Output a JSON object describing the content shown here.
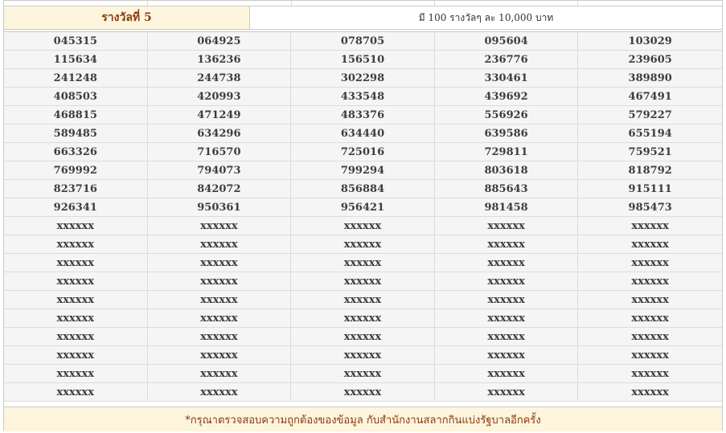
{
  "prize": {
    "title": "รางวัลที่ 5",
    "description": "มี 100 รางวัลๆ ละ 10,000 บาท"
  },
  "numbers": [
    [
      "045315",
      "064925",
      "078705",
      "095604",
      "103029"
    ],
    [
      "115634",
      "136236",
      "156510",
      "236776",
      "239605"
    ],
    [
      "241248",
      "244738",
      "302298",
      "330461",
      "389890"
    ],
    [
      "408503",
      "420993",
      "433548",
      "439692",
      "467491"
    ],
    [
      "468815",
      "471249",
      "483376",
      "556926",
      "579227"
    ],
    [
      "589485",
      "634296",
      "634440",
      "639586",
      "655194"
    ],
    [
      "663326",
      "716570",
      "725016",
      "729811",
      "759521"
    ],
    [
      "769992",
      "794073",
      "799294",
      "803618",
      "818792"
    ],
    [
      "823716",
      "842072",
      "856884",
      "885643",
      "915111"
    ],
    [
      "926341",
      "950361",
      "956421",
      "981458",
      "985473"
    ],
    [
      "xxxxxx",
      "xxxxxx",
      "xxxxxx",
      "xxxxxx",
      "xxxxxx"
    ],
    [
      "xxxxxx",
      "xxxxxx",
      "xxxxxx",
      "xxxxxx",
      "xxxxxx"
    ],
    [
      "xxxxxx",
      "xxxxxx",
      "xxxxxx",
      "xxxxxx",
      "xxxxxx"
    ],
    [
      "xxxxxx",
      "xxxxxx",
      "xxxxxx",
      "xxxxxx",
      "xxxxxx"
    ],
    [
      "xxxxxx",
      "xxxxxx",
      "xxxxxx",
      "xxxxxx",
      "xxxxxx"
    ],
    [
      "xxxxxx",
      "xxxxxx",
      "xxxxxx",
      "xxxxxx",
      "xxxxxx"
    ],
    [
      "xxxxxx",
      "xxxxxx",
      "xxxxxx",
      "xxxxxx",
      "xxxxxx"
    ],
    [
      "xxxxxx",
      "xxxxxx",
      "xxxxxx",
      "xxxxxx",
      "xxxxxx"
    ],
    [
      "xxxxxx",
      "xxxxxx",
      "xxxxxx",
      "xxxxxx",
      "xxxxxx"
    ],
    [
      "xxxxxx",
      "xxxxxx",
      "xxxxxx",
      "xxxxxx",
      "xxxxxx"
    ]
  ],
  "footer": {
    "note": "*กรุณาตรวจสอบความถูกต้องของข้อมูล กับสำนักงานสลากกินแบ่งรัฐบาลอีกครั้ง"
  },
  "colors": {
    "header_bg": "#fdf5dd",
    "accent_text": "#8b3a10",
    "row_bg": "#f5f5f5",
    "border": "#c9c9c9"
  }
}
